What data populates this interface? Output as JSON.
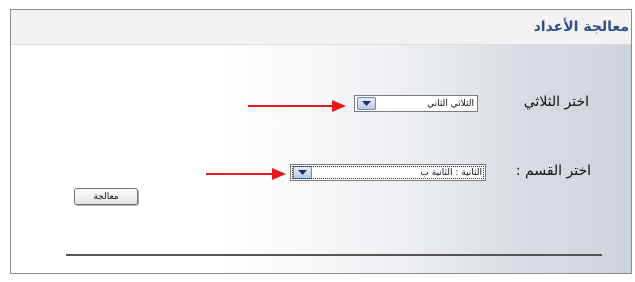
{
  "header": {
    "title": "معالجة الأعداد"
  },
  "form": {
    "trimester": {
      "label": "اختر الثلاثي",
      "selected_value": "الثلاثي الثاني"
    },
    "section": {
      "label": "اختر القسم :",
      "selected_value": "الثانية : الثانية ب"
    },
    "process_button_label": "معالجة"
  },
  "colors": {
    "arrow": "#e8191b",
    "title": "#2f4e8a"
  },
  "icons": {
    "dropdown": "chevron-down-icon",
    "pointer": "red-arrow-icon"
  }
}
